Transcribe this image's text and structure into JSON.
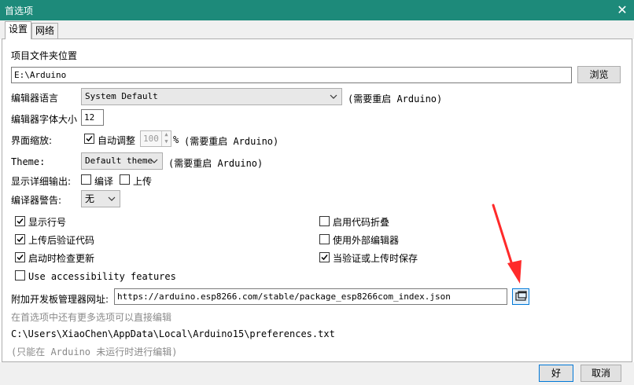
{
  "window": {
    "title": "首选项",
    "close_glyph": "✕"
  },
  "tabs": [
    {
      "label": "设置",
      "active": true
    },
    {
      "label": "网络",
      "active": false
    }
  ],
  "sketchbook": {
    "label": "项目文件夹位置",
    "value": "E:\\Arduino",
    "browse_label": "浏览"
  },
  "editor_language": {
    "label": "编辑器语言",
    "selected": "System Default",
    "note": "(需要重启 Arduino)"
  },
  "font_size": {
    "label": "编辑器字体大小",
    "value": "12"
  },
  "scaling": {
    "label": "界面缩放:",
    "auto_label": "自动调整",
    "auto_checked": true,
    "value": "100",
    "unit": "%",
    "note": "(需要重启 Arduino)"
  },
  "theme": {
    "label": "Theme:",
    "selected": "Default theme",
    "note": "(需要重启 Arduino)"
  },
  "verbose": {
    "label": "显示详细输出:",
    "compile_label": "编译",
    "compile_checked": false,
    "upload_label": "上传",
    "upload_checked": false
  },
  "warnings": {
    "label": "编译器警告:",
    "selected": "无"
  },
  "options_left": [
    {
      "label": "显示行号",
      "checked": true
    },
    {
      "label": "上传后验证代码",
      "checked": true
    },
    {
      "label": "启动时检查更新",
      "checked": true
    },
    {
      "label": "Use accessibility features",
      "checked": false
    }
  ],
  "options_right": [
    {
      "label": "启用代码折叠",
      "checked": false
    },
    {
      "label": "使用外部编辑器",
      "checked": false
    },
    {
      "label": "当验证或上传时保存",
      "checked": true
    }
  ],
  "boards_url": {
    "label": "附加开发板管理器网址:",
    "value": "https://arduino.esp8266.com/stable/package_esp8266com_index.json"
  },
  "more_prefs_hint": "在首选项中还有更多选项可以直接编辑",
  "prefs_path": "C:\\Users\\XiaoChen\\AppData\\Local\\Arduino15\\preferences.txt",
  "edit_hint": "(只能在 Arduino 未运行时进行编辑)",
  "footer": {
    "ok_label": "好",
    "cancel_label": "取消"
  },
  "colors": {
    "titlebar": "#1d8a7a",
    "annotation_arrow": "#ff2a2a",
    "focus_border": "#0078d7"
  },
  "icons": {
    "checkbox_checked": "☑",
    "dropdown": "chevron-down-icon",
    "url_editor": "window-edit-icon"
  }
}
